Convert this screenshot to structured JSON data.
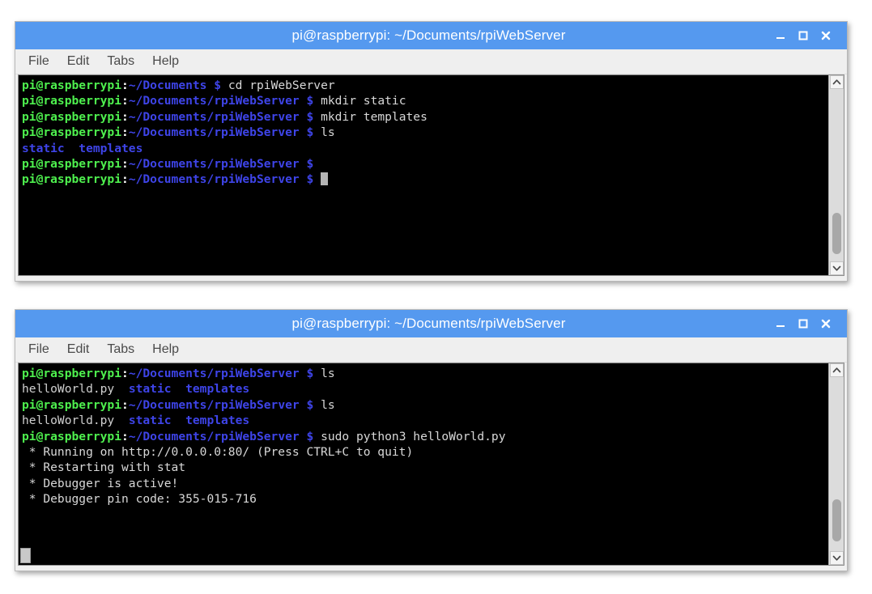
{
  "desktop": {
    "background": "#ffffff"
  },
  "theme": {
    "titlebar_bg": "#5599ef",
    "titlebar_fg": "#ffffff",
    "menubar_bg": "#efefef",
    "menu_fg": "#4a4a4a",
    "terminal_bg": "#000000",
    "prompt_green": "#4ef04e",
    "path_blue": "#3e44e8",
    "text_gray": "#d8d8d8",
    "cursor_gray": "#b4b4b4"
  },
  "icons": {
    "minimize": "minimize-icon",
    "maximize": "maximize-icon",
    "close": "close-icon",
    "scroll_up": "chevron-up-icon",
    "scroll_down": "chevron-down-icon"
  },
  "windows": [
    {
      "id": "terminal-window-1",
      "title": "pi@raspberrypi: ~/Documents/rpiWebServer",
      "buttons": {
        "minimize": "–",
        "maximize": "☐",
        "close": "✕"
      },
      "menu": [
        "File",
        "Edit",
        "Tabs",
        "Help"
      ],
      "scrollbar": {
        "thumb_top_pct": 72,
        "thumb_height_pct": 24
      },
      "lines": [
        {
          "segments": [
            {
              "text": "pi@raspberrypi",
              "style": "prompt"
            },
            {
              "text": ":",
              "style": "colon"
            },
            {
              "text": "~/Documents",
              "style": "path"
            },
            {
              "text": " ",
              "style": "cmd"
            },
            {
              "text": "$",
              "style": "dollar"
            },
            {
              "text": " cd rpiWebServer",
              "style": "cmd"
            }
          ]
        },
        {
          "segments": [
            {
              "text": "pi@raspberrypi",
              "style": "prompt"
            },
            {
              "text": ":",
              "style": "colon"
            },
            {
              "text": "~/Documents/rpiWebServer",
              "style": "path"
            },
            {
              "text": " ",
              "style": "cmd"
            },
            {
              "text": "$",
              "style": "dollar"
            },
            {
              "text": " mkdir static",
              "style": "cmd"
            }
          ]
        },
        {
          "segments": [
            {
              "text": "pi@raspberrypi",
              "style": "prompt"
            },
            {
              "text": ":",
              "style": "colon"
            },
            {
              "text": "~/Documents/rpiWebServer",
              "style": "path"
            },
            {
              "text": " ",
              "style": "cmd"
            },
            {
              "text": "$",
              "style": "dollar"
            },
            {
              "text": " mkdir templates",
              "style": "cmd"
            }
          ]
        },
        {
          "segments": [
            {
              "text": "pi@raspberrypi",
              "style": "prompt"
            },
            {
              "text": ":",
              "style": "colon"
            },
            {
              "text": "~/Documents/rpiWebServer",
              "style": "path"
            },
            {
              "text": " ",
              "style": "cmd"
            },
            {
              "text": "$",
              "style": "dollar"
            },
            {
              "text": " ls",
              "style": "cmd"
            }
          ]
        },
        {
          "segments": [
            {
              "text": "static  templates",
              "style": "dir"
            }
          ]
        },
        {
          "segments": [
            {
              "text": "pi@raspberrypi",
              "style": "prompt"
            },
            {
              "text": ":",
              "style": "colon"
            },
            {
              "text": "~/Documents/rpiWebServer",
              "style": "path"
            },
            {
              "text": " ",
              "style": "cmd"
            },
            {
              "text": "$",
              "style": "dollar"
            }
          ]
        },
        {
          "segments": [
            {
              "text": "pi@raspberrypi",
              "style": "prompt"
            },
            {
              "text": ":",
              "style": "colon"
            },
            {
              "text": "~/Documents/rpiWebServer",
              "style": "path"
            },
            {
              "text": " ",
              "style": "cmd"
            },
            {
              "text": "$",
              "style": "dollar"
            },
            {
              "text": " ",
              "style": "cmd"
            }
          ],
          "cursor": true
        }
      ]
    },
    {
      "id": "terminal-window-2",
      "title": "pi@raspberrypi: ~/Documents/rpiWebServer",
      "buttons": {
        "minimize": "–",
        "maximize": "☐",
        "close": "✕"
      },
      "menu": [
        "File",
        "Edit",
        "Tabs",
        "Help"
      ],
      "scrollbar": {
        "thumb_top_pct": 70,
        "thumb_height_pct": 24
      },
      "lines": [
        {
          "segments": [
            {
              "text": "pi@raspberrypi",
              "style": "prompt"
            },
            {
              "text": ":",
              "style": "colon"
            },
            {
              "text": "~/Documents/rpiWebServer",
              "style": "path"
            },
            {
              "text": " ",
              "style": "cmd"
            },
            {
              "text": "$",
              "style": "dollar"
            },
            {
              "text": " ls",
              "style": "cmd"
            }
          ]
        },
        {
          "segments": [
            {
              "text": "helloWorld.py",
              "style": "file"
            },
            {
              "text": "  ",
              "style": "cmd"
            },
            {
              "text": "static  templates",
              "style": "dir"
            }
          ]
        },
        {
          "segments": [
            {
              "text": "pi@raspberrypi",
              "style": "prompt"
            },
            {
              "text": ":",
              "style": "colon"
            },
            {
              "text": "~/Documents/rpiWebServer",
              "style": "path"
            },
            {
              "text": " ",
              "style": "cmd"
            },
            {
              "text": "$",
              "style": "dollar"
            },
            {
              "text": " ls",
              "style": "cmd"
            }
          ]
        },
        {
          "segments": [
            {
              "text": "helloWorld.py",
              "style": "file"
            },
            {
              "text": "  ",
              "style": "cmd"
            },
            {
              "text": "static  templates",
              "style": "dir"
            }
          ]
        },
        {
          "segments": [
            {
              "text": "pi@raspberrypi",
              "style": "prompt"
            },
            {
              "text": ":",
              "style": "colon"
            },
            {
              "text": "~/Documents/rpiWebServer",
              "style": "path"
            },
            {
              "text": " ",
              "style": "cmd"
            },
            {
              "text": "$",
              "style": "dollar"
            },
            {
              "text": " sudo python3 helloWorld.py",
              "style": "cmd"
            }
          ]
        },
        {
          "segments": [
            {
              "text": " * Running on http://0.0.0.0:80/ (Press CTRL+C to quit)",
              "style": "out"
            }
          ]
        },
        {
          "segments": [
            {
              "text": " * Restarting with stat",
              "style": "out"
            }
          ]
        },
        {
          "segments": [
            {
              "text": " * Debugger is active!",
              "style": "out"
            }
          ]
        },
        {
          "segments": [
            {
              "text": " * Debugger pin code: 355-015-716",
              "style": "out"
            }
          ]
        }
      ]
    }
  ]
}
